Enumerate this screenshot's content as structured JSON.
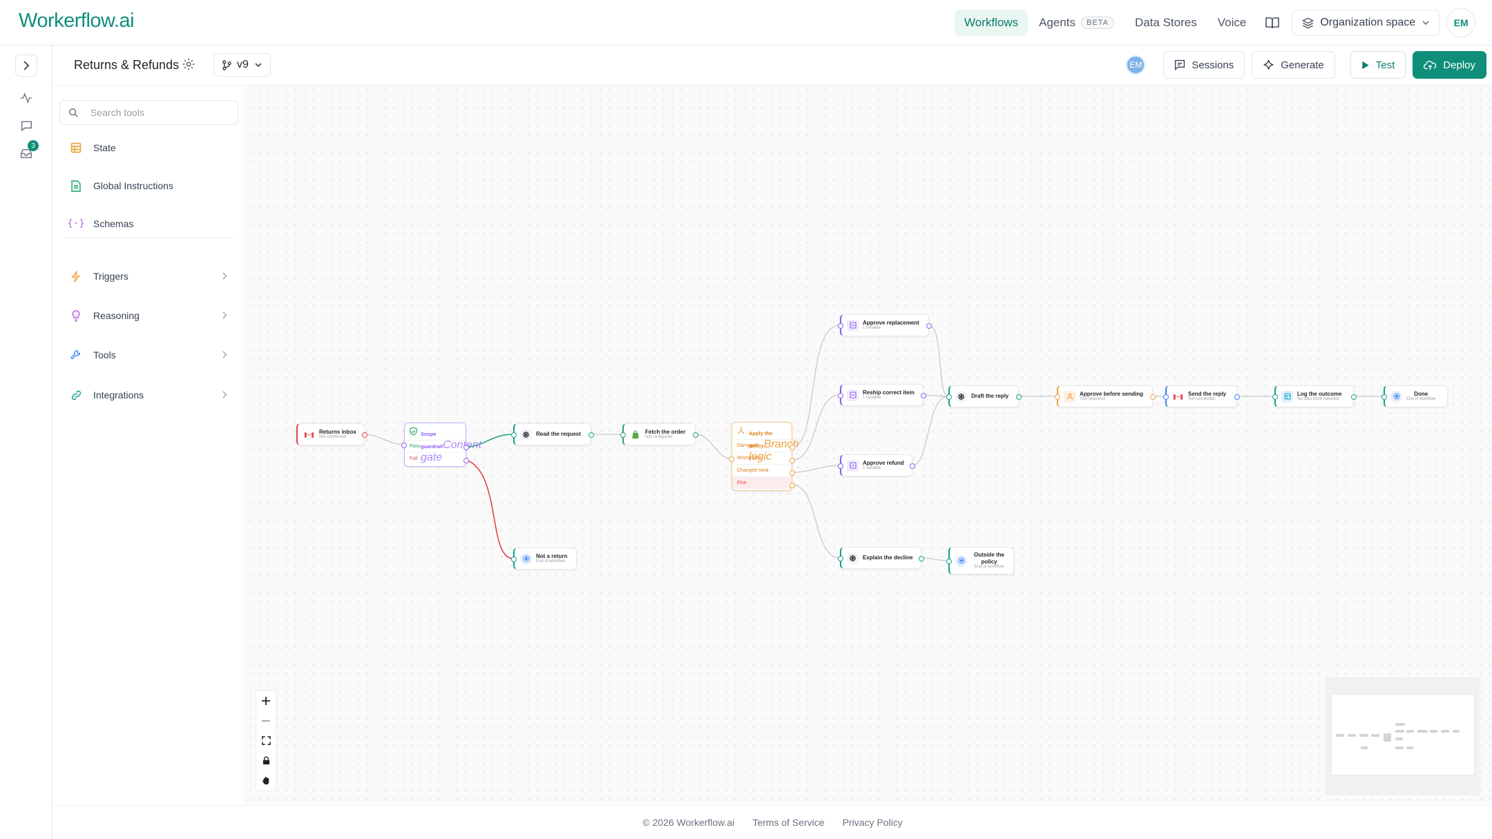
{
  "app": {
    "logo": "Workerflow.ai"
  },
  "topnav": {
    "items": [
      {
        "label": "Workflows",
        "active": true
      },
      {
        "label": "Agents",
        "badge": "BETA"
      },
      {
        "label": "Data Stores"
      },
      {
        "label": "Voice"
      }
    ],
    "org_label": "Organization space",
    "avatar": "EM"
  },
  "rail": {
    "inbox_badge": "3"
  },
  "workflow": {
    "title": "Returns & Refunds",
    "version": "v9"
  },
  "actions": {
    "collaborator": "EM",
    "sessions": "Sessions",
    "generate": "Generate",
    "test": "Test",
    "deploy": "Deploy"
  },
  "sidebar": {
    "search_placeholder": "Search tools",
    "top_items": [
      {
        "label": "State",
        "icon": "table-icon"
      },
      {
        "label": "Global Instructions",
        "icon": "document-icon"
      },
      {
        "label": "Schemas",
        "icon": "braces-icon"
      }
    ],
    "groups": [
      {
        "label": "Triggers",
        "icon": "bolt-icon"
      },
      {
        "label": "Reasoning",
        "icon": "bulb-icon"
      },
      {
        "label": "Tools",
        "icon": "wrench-icon"
      },
      {
        "label": "Integrations",
        "icon": "link-icon"
      }
    ]
  },
  "nodes": {
    "returns_inbox": {
      "title": "Returns inbox",
      "sub": "Not connected"
    },
    "guardrail": {
      "title": "Scope guardrail",
      "sub": "Content gate",
      "pass": "Pass",
      "fail": "Fail"
    },
    "read_request": {
      "title": "Read the request"
    },
    "fetch_order": {
      "title": "Fetch the order",
      "sub": "Not configured"
    },
    "policy": {
      "title": "Apply the policy",
      "sub": "Branch logic",
      "branches": [
        "Damaged",
        "Wrong item",
        "Changed mind",
        "Else"
      ]
    },
    "approve_replacement": {
      "title": "Approve replacement",
      "sub": "1 variable"
    },
    "reship": {
      "title": "Reship correct item",
      "sub": "1 variable"
    },
    "approve_refund": {
      "title": "Approve refund",
      "sub": "1 variable"
    },
    "draft_reply": {
      "title": "Draft the reply"
    },
    "approve_before": {
      "title": "Approve before sending",
      "sub": "Text response"
    },
    "send_reply": {
      "title": "Send the reply",
      "sub": "Not connected"
    },
    "log_outcome": {
      "title": "Log the outcome",
      "sub": "No data store selected"
    },
    "done": {
      "title": "Done",
      "sub": "End of workflow"
    },
    "not_return": {
      "title": "Not a return",
      "sub": "End of workflow"
    },
    "explain_decline": {
      "title": "Explain the decline"
    },
    "outside_policy": {
      "title": "Outside the policy",
      "sub": "End of workflow"
    }
  },
  "colors": {
    "brand": "#0f8f7a",
    "purple": "#8b5cf6",
    "orange": "#f0a040",
    "red": "#e0454a",
    "green": "#22a06b",
    "blue": "#3b82f6"
  },
  "footer": {
    "copyright": "© 2026 Workerflow.ai",
    "terms": "Terms of Service",
    "privacy": "Privacy Policy"
  }
}
